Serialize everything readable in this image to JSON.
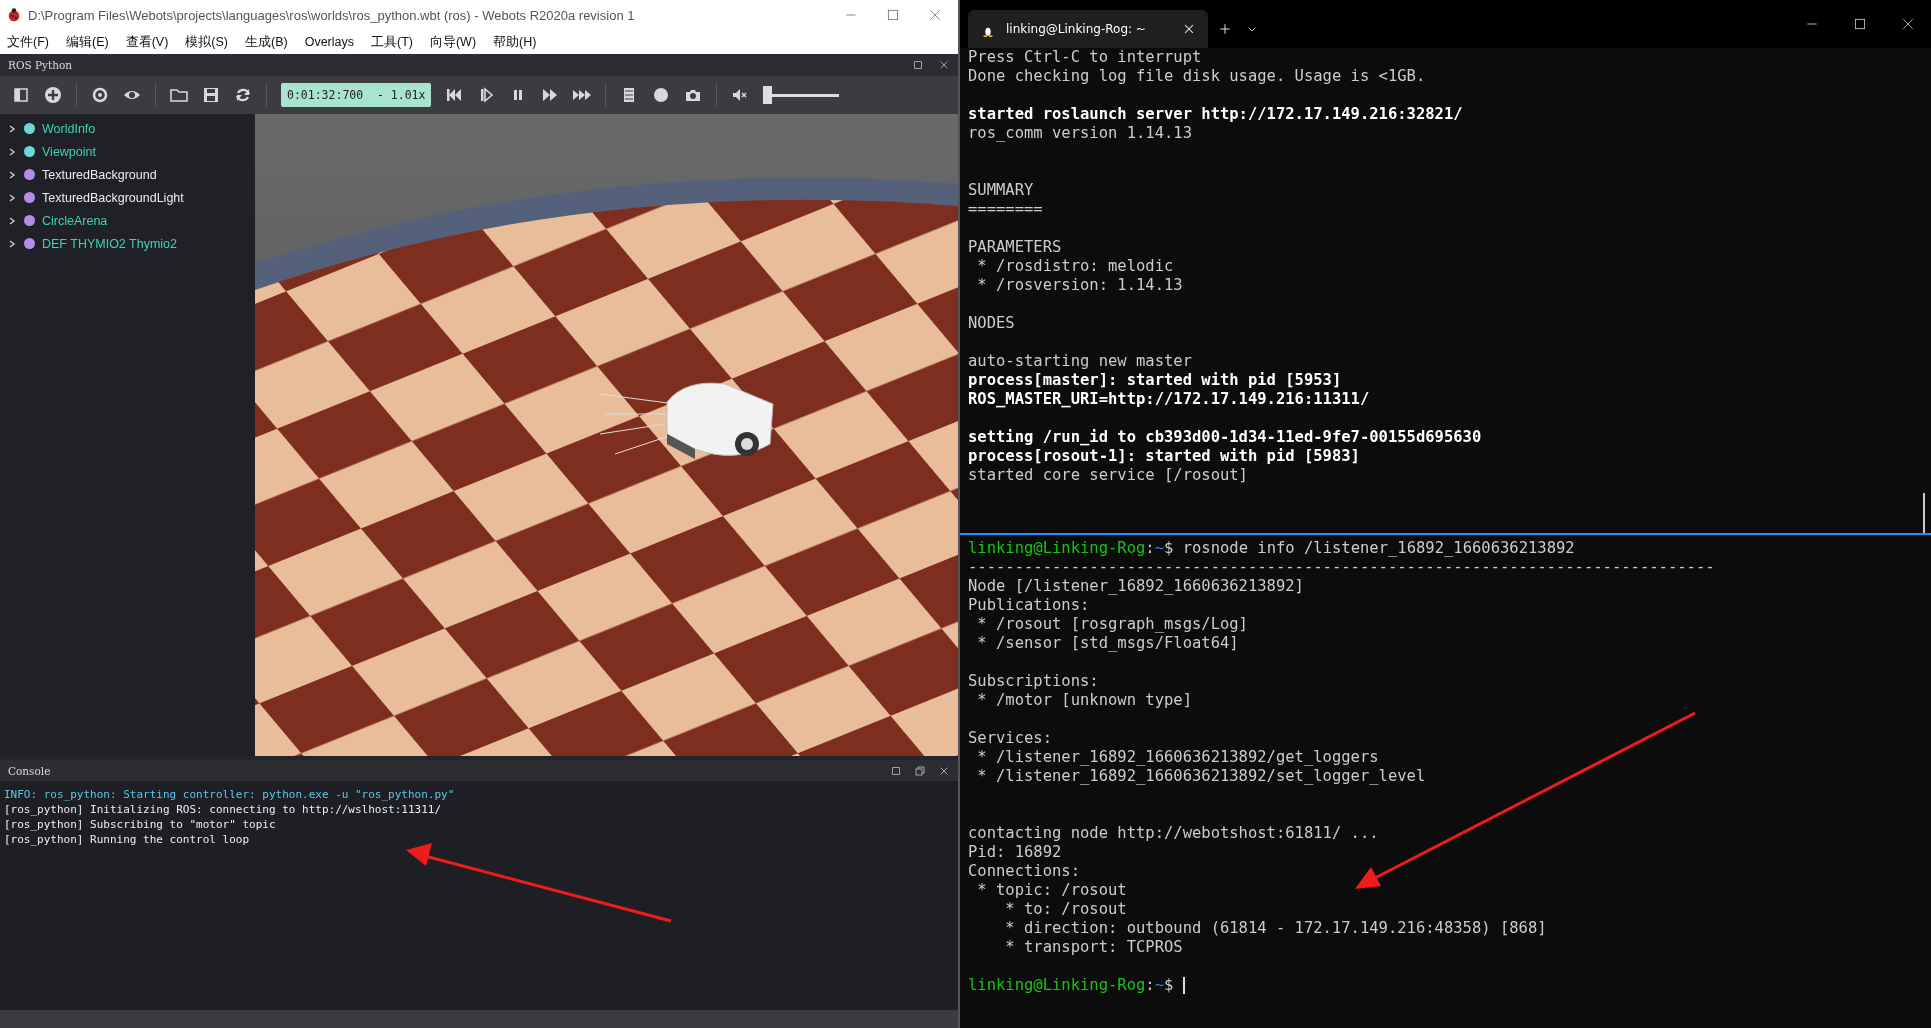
{
  "webots": {
    "title": "D:\\Program Files\\Webots\\projects\\languages\\ros\\worlds\\ros_python.wbt (ros) - Webots R2020a revision 1",
    "menu": [
      "文件(F)",
      "编辑(E)",
      "查看(V)",
      "模拟(S)",
      "生成(B)",
      "Overlays",
      "工具(T)",
      "向导(W)",
      "帮助(H)"
    ],
    "panel_title": "ROS Python",
    "toolbar": {
      "time": "0:01:32:700  - 1.01x",
      "volume": {
        "level": 0
      }
    },
    "scene_tree": [
      {
        "label": "WorldInfo",
        "color": "#6fd6d6",
        "highlighted": true,
        "expanded": false
      },
      {
        "label": "Viewpoint",
        "color": "#6fd6d6",
        "highlighted": true,
        "expanded": false
      },
      {
        "label": "TexturedBackground",
        "color": "#b58de8",
        "highlighted": false,
        "expanded": false
      },
      {
        "label": "TexturedBackgroundLight",
        "color": "#b58de8",
        "highlighted": false,
        "expanded": false
      },
      {
        "label": "CircleArena",
        "color": "#b58de8",
        "highlighted": true,
        "expanded": false
      },
      {
        "label": "DEF THYMIO2 Thymio2",
        "color": "#b58de8",
        "highlighted": true,
        "expanded": false
      }
    ],
    "console": {
      "title": "Console",
      "lines": [
        {
          "kind": "info",
          "text": "INFO: ros_python: Starting controller: python.exe -u \"ros_python.py\""
        },
        {
          "kind": "output",
          "text": "[ros_python] Initializing ROS: connecting to http://wslhost:11311/"
        },
        {
          "kind": "output",
          "text": "[ros_python] Subscribing to \"motor\" topic"
        },
        {
          "kind": "output",
          "text": "[ros_python] Running the control loop"
        }
      ]
    }
  },
  "terminal": {
    "tab": {
      "title": "linking@Linking-Rog: ~"
    },
    "top_pane": [
      {
        "kind": "text",
        "bold": false,
        "text": "Press Ctrl-C to interrupt"
      },
      {
        "kind": "text",
        "bold": false,
        "text": "Done checking log file disk usage. Usage is <1GB."
      },
      {
        "kind": "blank"
      },
      {
        "kind": "text",
        "bold": true,
        "text": "started roslaunch server http://172.17.149.216:32821/"
      },
      {
        "kind": "text",
        "bold": false,
        "text": "ros_comm version 1.14.13"
      },
      {
        "kind": "blank"
      },
      {
        "kind": "blank"
      },
      {
        "kind": "text",
        "bold": false,
        "text": "SUMMARY"
      },
      {
        "kind": "text",
        "bold": false,
        "text": "========"
      },
      {
        "kind": "blank"
      },
      {
        "kind": "text",
        "bold": false,
        "text": "PARAMETERS"
      },
      {
        "kind": "text",
        "bold": false,
        "text": " * /rosdistro: melodic"
      },
      {
        "kind": "text",
        "bold": false,
        "text": " * /rosversion: 1.14.13"
      },
      {
        "kind": "blank"
      },
      {
        "kind": "text",
        "bold": false,
        "text": "NODES"
      },
      {
        "kind": "blank"
      },
      {
        "kind": "text",
        "bold": false,
        "text": "auto-starting new master"
      },
      {
        "kind": "text",
        "bold": true,
        "text": "process[master]: started with pid [5953]"
      },
      {
        "kind": "text",
        "bold": true,
        "text": "ROS_MASTER_URI=http://172.17.149.216:11311/"
      },
      {
        "kind": "blank"
      },
      {
        "kind": "text",
        "bold": true,
        "text": "setting /run_id to cb393d00-1d34-11ed-9fe7-00155d695630"
      },
      {
        "kind": "text",
        "bold": true,
        "text": "process[rosout-1]: started with pid [5983]"
      },
      {
        "kind": "text",
        "bold": false,
        "text": "started core service [/rosout]"
      }
    ],
    "bottom_pane": [
      {
        "kind": "prompt",
        "user": "linking@Linking-Rog",
        "separator": ":",
        "path": "~",
        "symbol": "$",
        "command": "rosnode info /listener_16892_1660636213892"
      },
      {
        "kind": "text",
        "bold": false,
        "text": "--------------------------------------------------------------------------------"
      },
      {
        "kind": "text",
        "bold": false,
        "text": "Node [/listener_16892_1660636213892]"
      },
      {
        "kind": "text",
        "bold": false,
        "text": "Publications:"
      },
      {
        "kind": "text",
        "bold": false,
        "text": " * /rosout [rosgraph_msgs/Log]"
      },
      {
        "kind": "text",
        "bold": false,
        "text": " * /sensor [std_msgs/Float64]"
      },
      {
        "kind": "blank"
      },
      {
        "kind": "text",
        "bold": false,
        "text": "Subscriptions:"
      },
      {
        "kind": "text",
        "bold": false,
        "text": " * /motor [unknown type]"
      },
      {
        "kind": "blank"
      },
      {
        "kind": "text",
        "bold": false,
        "text": "Services:"
      },
      {
        "kind": "text",
        "bold": false,
        "text": " * /listener_16892_1660636213892/get_loggers"
      },
      {
        "kind": "text",
        "bold": false,
        "text": " * /listener_16892_1660636213892/set_logger_level"
      },
      {
        "kind": "blank"
      },
      {
        "kind": "blank"
      },
      {
        "kind": "text",
        "bold": false,
        "text": "contacting node http://webotshost:61811/ ..."
      },
      {
        "kind": "text",
        "bold": false,
        "text": "Pid: 16892"
      },
      {
        "kind": "text",
        "bold": false,
        "text": "Connections:"
      },
      {
        "kind": "text",
        "bold": false,
        "text": " * topic: /rosout"
      },
      {
        "kind": "text",
        "bold": false,
        "text": "    * to: /rosout"
      },
      {
        "kind": "text",
        "bold": false,
        "text": "    * direction: outbound (61814 - 172.17.149.216:48358) [868]"
      },
      {
        "kind": "text",
        "bold": false,
        "text": "    * transport: TCPROS"
      },
      {
        "kind": "blank"
      },
      {
        "kind": "prompt",
        "user": "linking@Linking-Rog",
        "separator": ":",
        "path": "~",
        "symbol": "$"
      }
    ]
  }
}
